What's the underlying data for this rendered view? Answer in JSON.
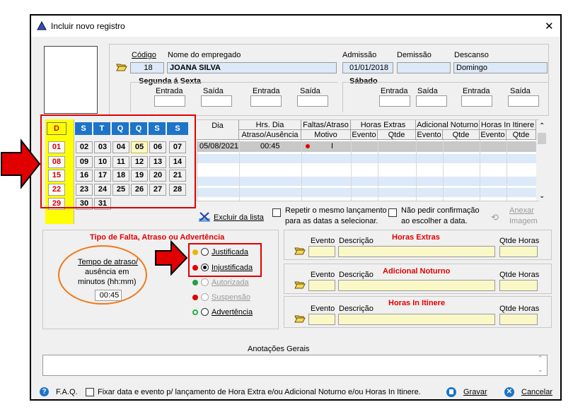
{
  "window": {
    "title": "Incluir novo registro",
    "close": "✕"
  },
  "employee": {
    "codigo_label": "Código",
    "nome_label": "Nome do empregado",
    "admissao_label": "Admissão",
    "demissao_label": "Demissão",
    "descanso_label": "Descanso",
    "codigo": "18",
    "nome": "JOANA SILVA",
    "admissao": "01/01/2018",
    "demissao": "",
    "descanso": "Domingo"
  },
  "schedule": {
    "weekday_title": "Segunda á Sexta",
    "saturday_title": "Sábado",
    "entrada": "Entrada",
    "saida": "Saída"
  },
  "calendar": {
    "headers": [
      "D",
      "S",
      "T",
      "Q",
      "Q",
      "S",
      "S"
    ],
    "sundays": [
      "01",
      "08",
      "15",
      "22",
      "29"
    ],
    "weeks": [
      [
        "02",
        "03",
        "04",
        "05",
        "06",
        "07"
      ],
      [
        "09",
        "10",
        "11",
        "12",
        "13",
        "14"
      ],
      [
        "16",
        "17",
        "18",
        "19",
        "20",
        "21"
      ],
      [
        "23",
        "24",
        "25",
        "26",
        "27",
        "28"
      ],
      [
        "30",
        "31"
      ]
    ]
  },
  "grid": {
    "col_dia": "Dia",
    "col_hrs": "Hrs. Dia",
    "col_hrs_sub": "Atraso/Ausência",
    "col_faltas": "Faltas/Atraso",
    "col_motivo": "Motivo",
    "col_horas_extras": "Horas Extras",
    "col_adicional": "Adicional Noturno",
    "col_itinere": "Horas In Itinere",
    "col_evento": "Evento",
    "col_qtde": "Qtde",
    "row1": {
      "dia": "05/08/2021",
      "hrs": "00:45",
      "motivo": "I"
    }
  },
  "actions": {
    "excluir": "Excluir da lista",
    "repetir": "Repetir o mesmo lançamento para as datas a selecionar.",
    "repetir_l1": "Repetir o mesmo lançamento",
    "repetir_l2": "para as datas a selecionar.",
    "nao_pedir_l1": "Não pedir confirmação",
    "nao_pedir_l2": "ao escolher a data.",
    "anexar_l1": "Anexar",
    "anexar_l2": "Imagem"
  },
  "tipo": {
    "title": "Tipo de Falta, Atraso ou Advertência",
    "tempo_l1": "Tempo de atraso/",
    "tempo_l2": "ausência em",
    "tempo_l3": "minutos (hh:mm)",
    "tempo_value": "00:45",
    "options": [
      "Justificada",
      "Injustificada",
      "Autorizada",
      "Suspensão",
      "Advertência"
    ],
    "selected": "Injustificada"
  },
  "sections": {
    "evento": "Evento",
    "descricao": "Descrição",
    "qtde_horas": "Qtde Horas",
    "horas_extras": "Horas Extras",
    "adicional_noturno": "Adicional Noturno",
    "horas_itinere": "Horas In Itinere"
  },
  "notes": {
    "title": "Anotações Gerais"
  },
  "footer": {
    "faq": "F.A.Q.",
    "fixar": "Fixar data e evento p/ lançamento de Hora Extra e/ou Adicional Noturno e/ou Horas In Itinere.",
    "gravar": "Gravar",
    "cancelar": "Cancelar"
  },
  "colors": {
    "accent": "#1e74c7",
    "highlight_red": "#e00000",
    "annotation_orange": "#f07a1a",
    "sunday_yellow": "#ffff00"
  }
}
